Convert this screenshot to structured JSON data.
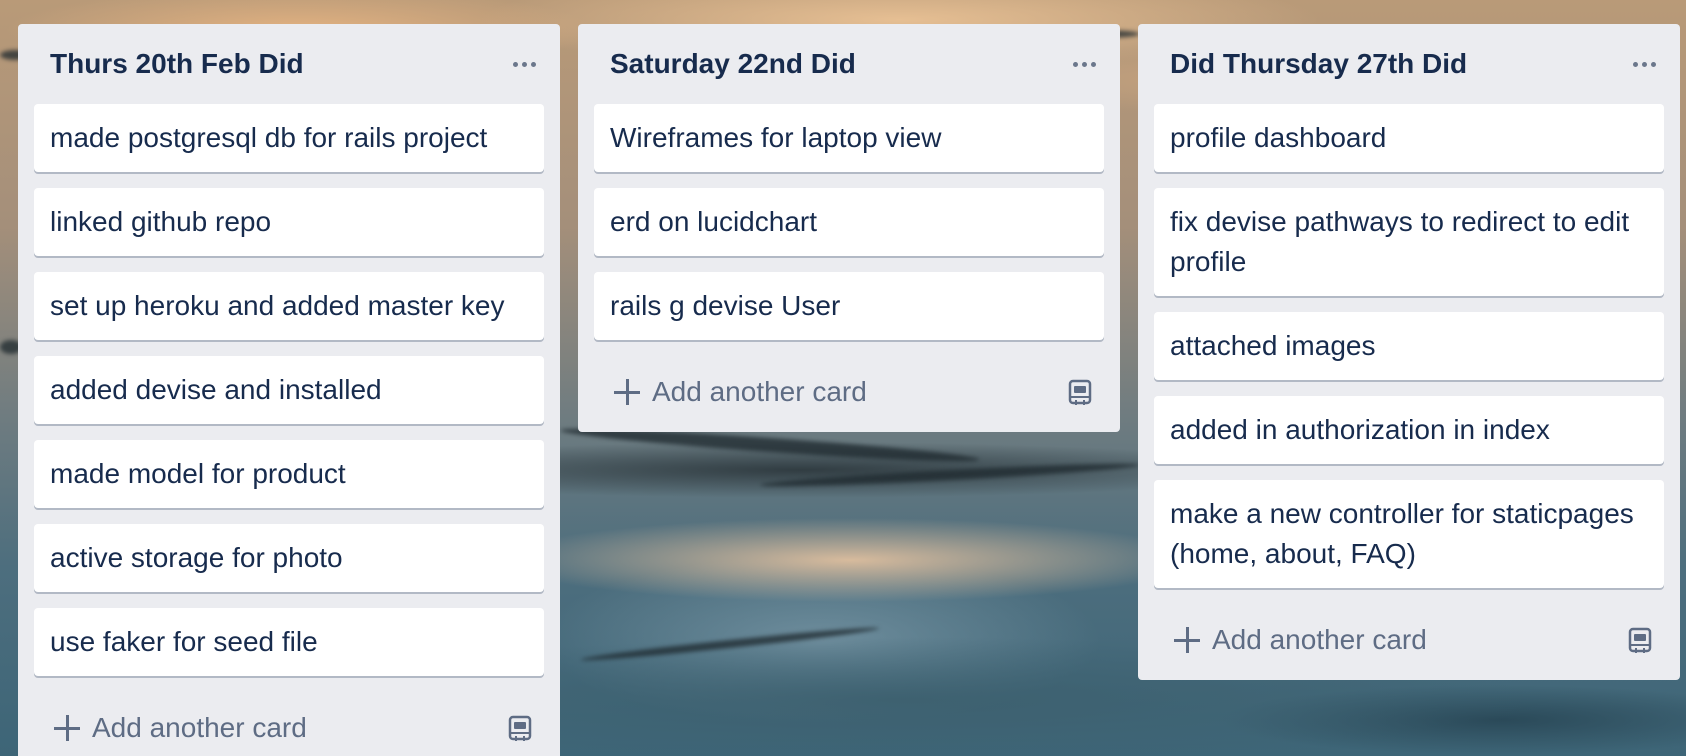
{
  "board": {
    "lists": [
      {
        "title": "Thurs 20th Feb Did",
        "cards": [
          "made postgresql db for rails project",
          "linked github repo",
          "set up heroku and added master key",
          "added devise and installed",
          "made model for product",
          "active storage for photo",
          "use faker for seed file"
        ],
        "add_label": "Add another card"
      },
      {
        "title": "Saturday 22nd Did",
        "cards": [
          "Wireframes for laptop view",
          "erd on lucidchart",
          "rails g devise User"
        ],
        "add_label": "Add another card"
      },
      {
        "title": "Did Thursday 27th Did",
        "cards": [
          "profile dashboard",
          "fix devise pathways to redirect to edit profile",
          "attached images",
          "added in authorization in index",
          "make a new controller for staticpages (home, about, FAQ)"
        ],
        "add_label": "Add another card"
      }
    ]
  },
  "icons": {
    "menu": "more-horizontal-icon",
    "add": "plus-icon",
    "template": "card-template-icon"
  },
  "colors": {
    "list_bg": "#ebecf0",
    "card_bg": "#ffffff",
    "title_text": "#172b4d",
    "muted_text": "#5e6c84"
  }
}
